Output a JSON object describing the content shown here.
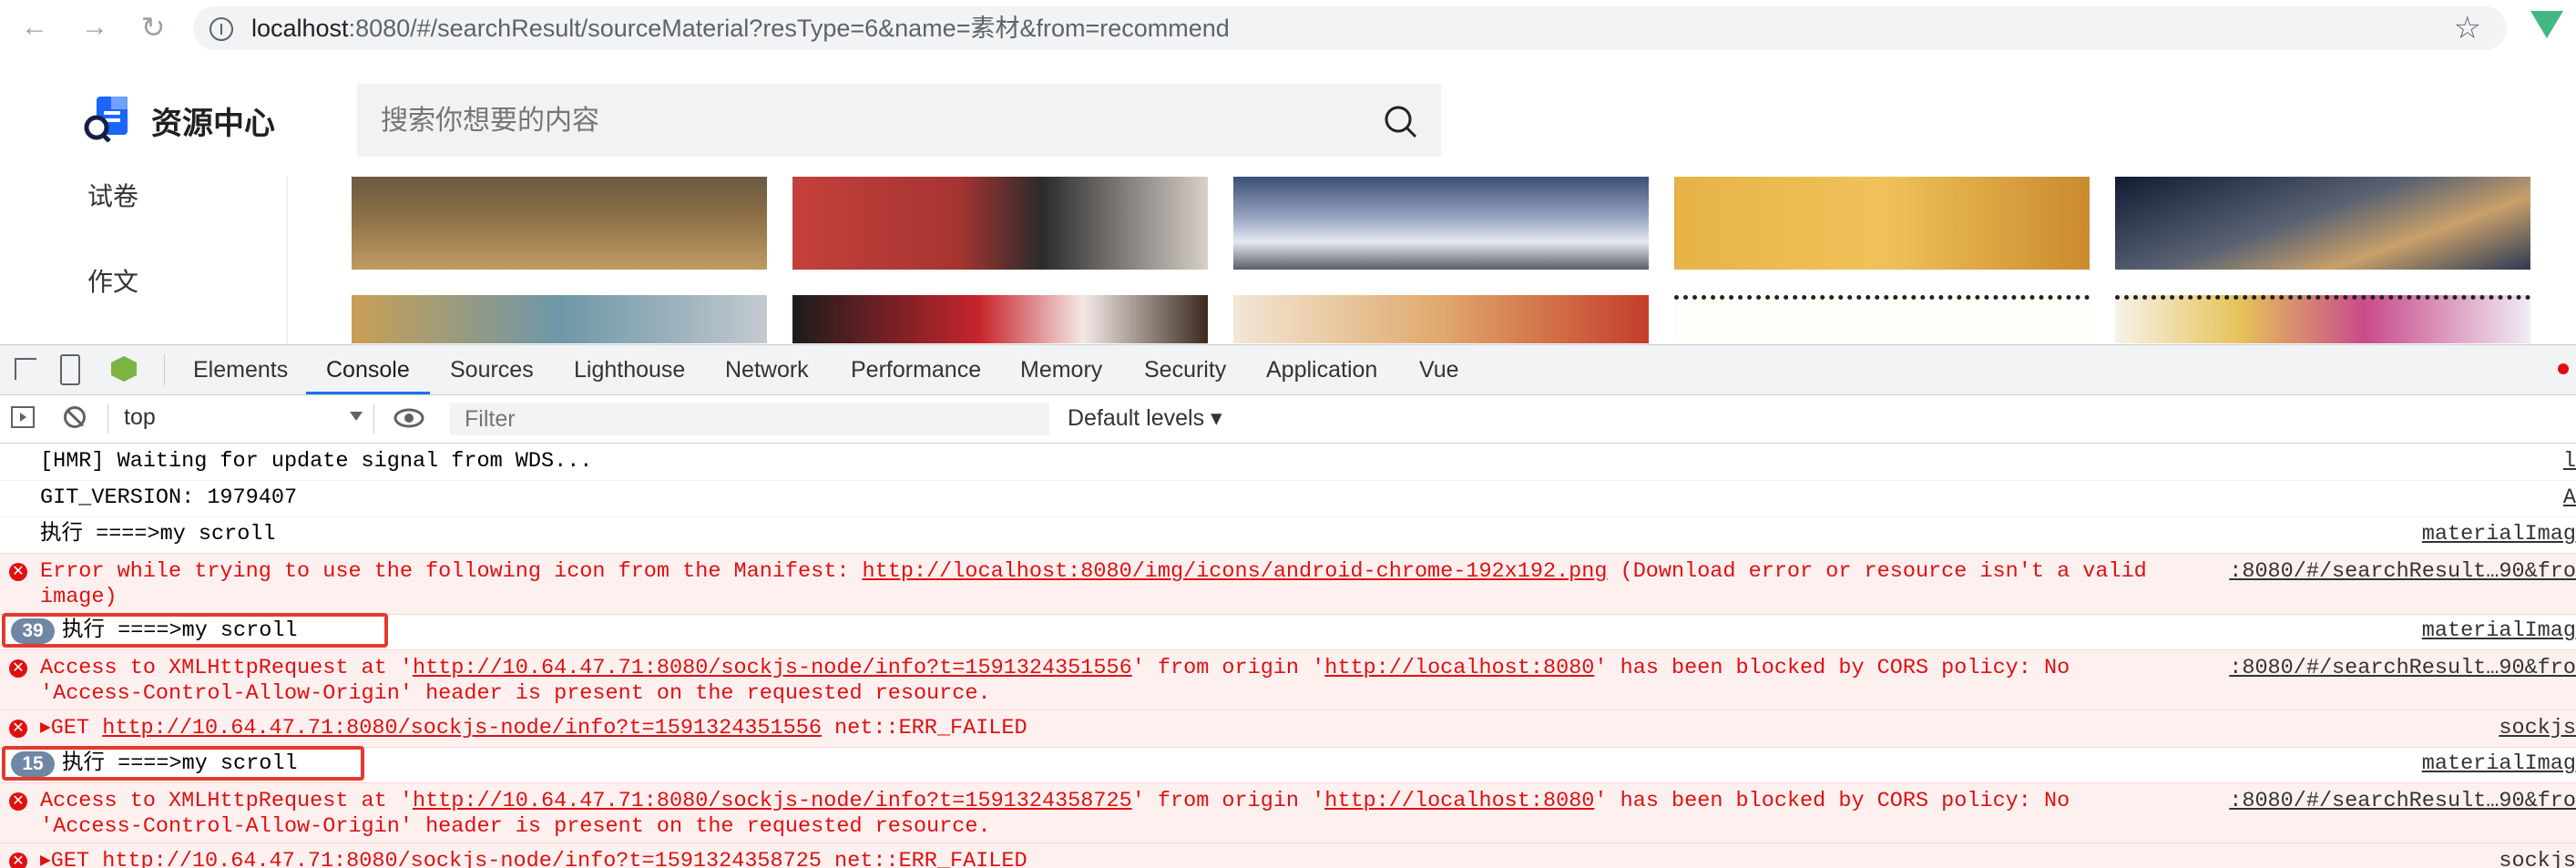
{
  "browser": {
    "url_host": "localhost",
    "url_rest": ":8080/#/searchResult/sourceMaterial?resType=6&name=素材&from=recommend",
    "back_icon": "arrow-left-icon",
    "forward_icon": "arrow-right-icon",
    "reload_icon": "reload-icon",
    "star_icon": "star-icon"
  },
  "site": {
    "brand": "资源中心",
    "search_placeholder": "搜索你想要的内容",
    "sidebar": [
      "试卷",
      "作文"
    ]
  },
  "devtools": {
    "tabs": [
      "Elements",
      "Console",
      "Sources",
      "Lighthouse",
      "Network",
      "Performance",
      "Memory",
      "Security",
      "Application",
      "Vue"
    ],
    "active_tab": "Console",
    "context": "top",
    "filter_placeholder": "Filter",
    "levels": "Default levels ▾"
  },
  "console": {
    "lines": [
      {
        "text": "[HMR] Waiting for update signal from WDS...",
        "src": "l"
      },
      {
        "text": "GIT_VERSION: 1979407",
        "src": "A"
      },
      {
        "text": "执行 ====>my scroll",
        "src": "materialImag"
      },
      {
        "pre": "Error while trying to use the following icon from the Manifest: ",
        "link": "http://localhost:8080/img/icons/android-chrome-192x192.png",
        "post": " (Download error or resource isn't a valid",
        "line2": "image)",
        "src": ":8080/#/searchResult…90&fro"
      },
      {
        "count": "39",
        "text": "执行 ====>my scroll",
        "src": "materialImag"
      },
      {
        "pre": "Access to XMLHttpRequest at '",
        "link": "http://10.64.47.71:8080/sockjs-node/info?t=1591324351556",
        "mid": "' from origin '",
        "link2": "http://localhost:8080",
        "post": "' has been blocked by CORS policy: No",
        "line2": "'Access-Control-Allow-Origin' header is present on the requested resource.",
        "src": ":8080/#/searchResult…90&fro"
      },
      {
        "pre": "▸GET ",
        "link": "http://10.64.47.71:8080/sockjs-node/info?t=1591324351556",
        "post": " net::ERR_FAILED",
        "src": "sockjs"
      },
      {
        "count": "15",
        "text": "执行 ====>my scroll",
        "src": "materialImag"
      },
      {
        "pre": "Access to XMLHttpRequest at '",
        "link": "http://10.64.47.71:8080/sockjs-node/info?t=1591324358725",
        "mid": "' from origin '",
        "link2": "http://localhost:8080",
        "post": "' has been blocked by CORS policy: No",
        "line2": "'Access-Control-Allow-Origin' header is present on the requested resource.",
        "src": ":8080/#/searchResult…90&fro"
      },
      {
        "pre": "▸GET ",
        "link": "http://10.64.47.71:8080/sockjs-node/info?t=1591324358725",
        "post": " net::ERR_FAILED",
        "src": "sockjs"
      }
    ]
  },
  "colors": {
    "error_text": "#e0100f",
    "error_bg": "#fff0f0",
    "active_tab": "#1a73e8",
    "highlight_box": "#e23b2e"
  }
}
